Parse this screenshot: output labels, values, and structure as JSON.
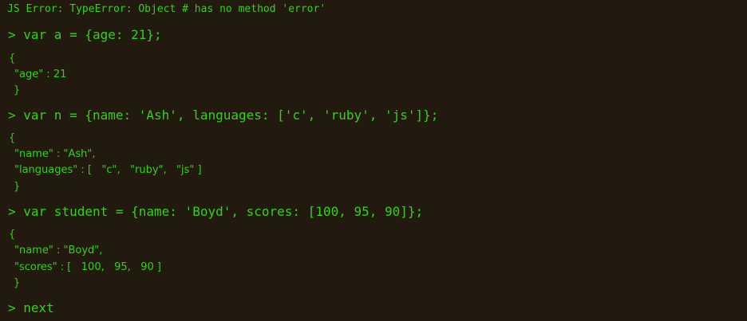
{
  "console": {
    "error_line": "JS Error: TypeError: Object # has no method 'error'",
    "entries": [
      {
        "command": "> var a = {age: 21};",
        "output": [
          "{",
          "\"age\" : 21",
          "}"
        ]
      },
      {
        "command": "> var n = {name: 'Ash', languages: ['c', 'ruby', 'js']};",
        "output": [
          "{",
          "\"name\" : \"Ash\",",
          "\"languages\" : [   \"c\",   \"ruby\",   \"js\" ]",
          "}"
        ]
      },
      {
        "command": "> var student = {name: 'Boyd', scores: [100, 95, 90]};",
        "output": [
          "{",
          "\"name\" : \"Boyd\",",
          "\"scores\" : [   100,   95,   90 ]",
          "}"
        ]
      }
    ],
    "current_input": "> next",
    "text_color": "#35d20f",
    "background_color": "#221a0f"
  }
}
